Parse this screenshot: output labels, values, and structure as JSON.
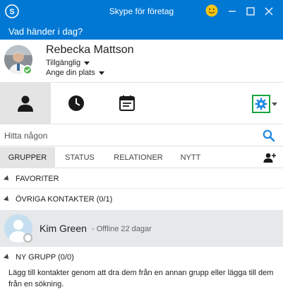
{
  "window": {
    "title": "Skype för företag",
    "colors": {
      "accent": "#0078d4",
      "presence_available": "#5cb85c",
      "settings_focus": "#19a33f"
    }
  },
  "note": {
    "text": "Vad händer i dag?"
  },
  "user": {
    "name": "Rebecka Mattson",
    "status": "Tillgänglig",
    "location": "Ange din plats"
  },
  "subtabs": [
    "GRUPPER",
    "STATUS",
    "RELATIONER",
    "NYTT"
  ],
  "search": {
    "placeholder": "Hitta någon"
  },
  "groups": {
    "favorites": "FAVORITER",
    "other": "ÖVRIGA KONTAKTER (0/1)",
    "new": "NY GRUPP (0/0)"
  },
  "contacts": [
    {
      "name": "Kim Green",
      "status": "- Offline 22 dagar"
    }
  ],
  "empty_group_text": "Lägg till kontakter genom att dra dem från en annan grupp eller lägga till dem från en sökning."
}
